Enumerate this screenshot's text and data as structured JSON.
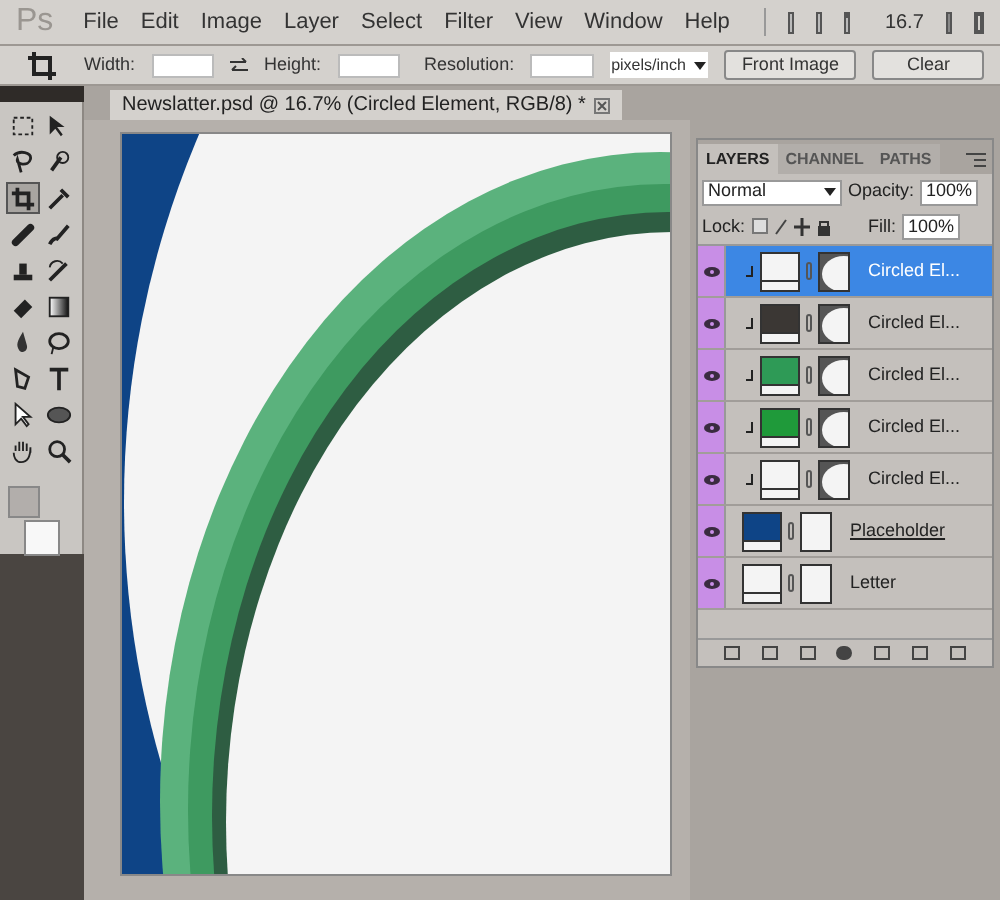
{
  "menu_bar": {
    "logo": "Ps",
    "items": [
      "File",
      "Edit",
      "Image",
      "Layer",
      "Select",
      "Filter",
      "View",
      "Window",
      "Help"
    ],
    "zoom": "16.7"
  },
  "options_bar": {
    "width_label": "Width:",
    "height_label": "Height:",
    "resolution_label": "Resolution:",
    "unit": "pixels/inch",
    "buttons": [
      "Front Image",
      "Clear"
    ]
  },
  "tools": [
    {
      "kind": "marquee",
      "selected": false
    },
    {
      "kind": "move",
      "selected": false
    },
    {
      "kind": "lasso",
      "selected": false
    },
    {
      "kind": "quick-select",
      "selected": false
    },
    {
      "kind": "crop",
      "selected": true
    },
    {
      "kind": "eyedropper",
      "selected": false
    },
    {
      "kind": "healing",
      "selected": false
    },
    {
      "kind": "brush",
      "selected": false
    },
    {
      "kind": "stamp",
      "selected": false
    },
    {
      "kind": "history-brush",
      "selected": false
    },
    {
      "kind": "eraser",
      "selected": false
    },
    {
      "kind": "gradient",
      "selected": false
    },
    {
      "kind": "blur",
      "selected": false
    },
    {
      "kind": "dodge",
      "selected": false
    },
    {
      "kind": "pen",
      "selected": false
    },
    {
      "kind": "type",
      "selected": false
    },
    {
      "kind": "path-select",
      "selected": false
    },
    {
      "kind": "shape",
      "selected": false
    },
    {
      "kind": "hand",
      "selected": false
    },
    {
      "kind": "zoom",
      "selected": false
    }
  ],
  "document": {
    "tab_title": "Newslatter.psd @ 16.7% (Circled Element, RGB/8) *"
  },
  "layers_panel": {
    "tabs": [
      {
        "label": "LAYERS",
        "selected": true
      },
      {
        "label": "CHANNEL",
        "selected": false
      },
      {
        "label": "PATHS",
        "selected": false
      }
    ],
    "blend_mode": "Normal",
    "opacity_label": "Opacity:",
    "opacity": "100%",
    "lock_label": "Lock:",
    "fill_label": "Fill:",
    "fill": "100%",
    "layers": [
      {
        "name": "Circled El...",
        "color": "#f4f4f4",
        "kind": "clipped",
        "underlined": false,
        "selected": true
      },
      {
        "name": "Circled El...",
        "color": "#3b3734",
        "kind": "clipped",
        "underlined": false,
        "selected": false
      },
      {
        "name": "Circled El...",
        "color": "#2e9a56",
        "kind": "clipped",
        "underlined": false,
        "selected": false
      },
      {
        "name": "Circled El...",
        "color": "#1f9a3a",
        "kind": "clipped",
        "underlined": false,
        "selected": false
      },
      {
        "name": "Circled El...",
        "color": "#f4f4f4",
        "kind": "clipped",
        "underlined": false,
        "selected": false
      },
      {
        "name": "Placeholder",
        "color": "#0e4486",
        "kind": "plain",
        "underlined": true,
        "selected": false
      },
      {
        "name": "Letter",
        "color": "#f4f4f4",
        "kind": "plain",
        "underlined": false,
        "selected": false
      }
    ]
  }
}
